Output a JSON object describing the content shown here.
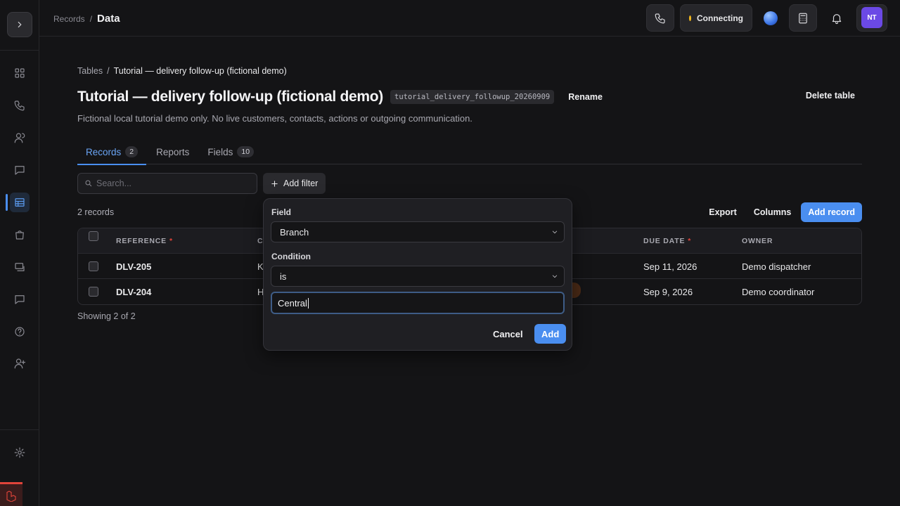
{
  "topbar": {
    "breadcrumb_parent": "Records",
    "breadcrumb_sep": "/",
    "breadcrumb_current": "Data",
    "status_label": "Connecting",
    "status_color": "#f4b91d",
    "avatar_initials": "NT",
    "avatar_color": "#6b49e6"
  },
  "sidebar": {
    "items": [
      "dashboard-icon",
      "phone-icon",
      "contacts-icon",
      "chat-icon",
      "table-icon",
      "bag-icon",
      "campaign-icon",
      "message-icon",
      "help-icon",
      "add-user-icon",
      "settings-icon"
    ]
  },
  "page": {
    "breadcrumb_parent": "Tables",
    "breadcrumb_sep": "/",
    "breadcrumb_current": "Tutorial — delivery follow-up (fictional demo)",
    "title": "Tutorial — delivery follow-up (fictional demo)",
    "table_id": "tutorial_delivery_followup_20260909",
    "rename_label": "Rename",
    "delete_label": "Delete table",
    "subtitle": "Fictional local tutorial demo only. No live customers, contacts, actions or outgoing communication."
  },
  "tabs": [
    {
      "label": "Records",
      "count": "2"
    },
    {
      "label": "Reports"
    },
    {
      "label": "Fields",
      "count": "10"
    }
  ],
  "toolbar": {
    "search_placeholder": "Search...",
    "add_filter_label": "Add filter",
    "record_count": "2 records",
    "export_label": "Export",
    "columns_label": "Columns",
    "add_record_label": "Add record"
  },
  "table": {
    "headers": {
      "reference": "REFERENCE",
      "second": "C",
      "due_date": "DUE DATE",
      "owner": "OWNER",
      "required_mark": "*"
    },
    "rows": [
      {
        "reference": "DLV-205",
        "second": "K",
        "due_date": "Sep 11, 2026",
        "owner": "Demo dispatcher"
      },
      {
        "reference": "DLV-204",
        "second": "H",
        "due_date": "Sep 9, 2026",
        "owner": "Demo coordinator"
      }
    ],
    "showing": "Showing 2 of 2"
  },
  "filter_popover": {
    "field_label": "Field",
    "field_value": "Branch",
    "condition_label": "Condition",
    "condition_value": "is",
    "value": "Central",
    "cancel_label": "Cancel",
    "add_label": "Add"
  },
  "colors": {
    "accent": "#4a8ef0",
    "required": "#e0443a"
  }
}
